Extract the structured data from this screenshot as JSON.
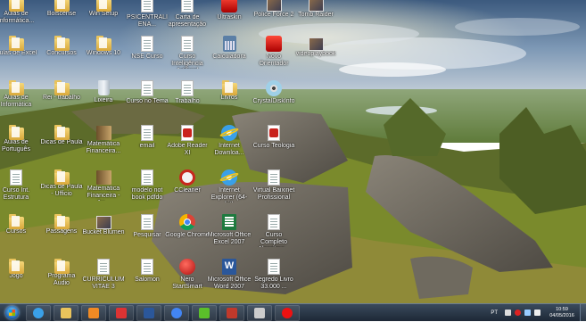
{
  "desktop": {
    "icons": [
      {
        "label": "Aulas de Informática...",
        "icon": "folder-icon",
        "type": "folder"
      },
      {
        "label": "Boiscense",
        "icon": "folder-icon",
        "type": "folder"
      },
      {
        "label": "Win Setup",
        "icon": "folder-icon",
        "type": "folder"
      },
      {
        "label": "PSICENTRALIENA...",
        "icon": "document-icon",
        "type": "doc"
      },
      {
        "label": "Carta de apresentação",
        "icon": "document-icon",
        "type": "doc"
      },
      {
        "label": "Ultraskin",
        "icon": "app-red-icon",
        "type": "redsq"
      },
      {
        "label": "Police Force 2",
        "icon": "game-icon",
        "type": "img"
      },
      {
        "label": "Tomb Raider",
        "icon": "game-icon",
        "type": "img"
      },
      {
        "label": "Aulas de Excel",
        "icon": "folder-icon",
        "type": "folder"
      },
      {
        "label": "Concursos",
        "icon": "folder-icon",
        "type": "folder"
      },
      {
        "label": "Windows 10",
        "icon": "folder-icon",
        "type": "folder"
      },
      {
        "label": "NSE Curso",
        "icon": "document-icon",
        "type": "doc"
      },
      {
        "label": "Curso Inteligência Artificial",
        "icon": "document-icon",
        "type": "doc"
      },
      {
        "label": "Calculadora",
        "icon": "calculator-icon",
        "type": "calc"
      },
      {
        "label": "Novo Orientador",
        "icon": "shortcut-icon",
        "type": "redsq"
      },
      {
        "label": "videoplaybook",
        "icon": "image-icon",
        "type": "img"
      },
      {
        "label": "Aulas de Informática",
        "icon": "folder-icon",
        "type": "folder"
      },
      {
        "label": "Rei - trabalho",
        "icon": "folder-icon",
        "type": "folder"
      },
      {
        "label": "Lixeira",
        "icon": "recycle-bin-icon",
        "type": "bin"
      },
      {
        "label": "Curso no Tema",
        "icon": "document-icon",
        "type": "doc"
      },
      {
        "label": "Trabalho",
        "icon": "document-icon",
        "type": "doc"
      },
      {
        "label": "Livros",
        "icon": "folder-icon",
        "type": "folder"
      },
      {
        "label": "CrystalDiskInfo",
        "icon": "disc-icon",
        "type": "cdrom"
      },
      {
        "label": "Aulas de Português",
        "icon": "folder-icon",
        "type": "folder"
      },
      {
        "label": "Dicas de Paula",
        "icon": "folder-icon",
        "type": "folder"
      },
      {
        "label": "Matemática Financeira...",
        "icon": "book-icon",
        "type": "book"
      },
      {
        "label": "email",
        "icon": "document-icon",
        "type": "doc"
      },
      {
        "label": "Adobe Reader XI",
        "icon": "pdf-icon",
        "type": "pdf"
      },
      {
        "label": "Internet Downloa...",
        "icon": "ie-icon",
        "type": "ie"
      },
      {
        "label": "Curso Teologia",
        "icon": "pdf-icon",
        "type": "pdf"
      },
      {
        "label": "Curso Int. Estrutura",
        "icon": "document-icon",
        "type": "doc"
      },
      {
        "label": "Dicas de Paula - Ufficio",
        "icon": "folder-icon",
        "type": "folder"
      },
      {
        "label": "Matemática Financeira - Au...",
        "icon": "book-icon",
        "type": "book"
      },
      {
        "label": "modelo not book pdfdo",
        "icon": "document-icon",
        "type": "doc"
      },
      {
        "label": "CCleaner",
        "icon": "ccleaner-icon",
        "type": "ccleaner"
      },
      {
        "label": "Internet Explorer (64-bit)",
        "icon": "ie-icon",
        "type": "ie"
      },
      {
        "label": "Virtual Baixinet Profissional",
        "icon": "document-icon",
        "type": "doc"
      },
      {
        "label": "Cursos",
        "icon": "folder-icon",
        "type": "folder"
      },
      {
        "label": "Passagens",
        "icon": "folder-icon",
        "type": "folder"
      },
      {
        "label": "Bucket Blumen",
        "icon": "image-icon",
        "type": "img"
      },
      {
        "label": "Pesquisar",
        "icon": "document-icon",
        "type": "doc"
      },
      {
        "label": "Google Chrome",
        "icon": "chrome-icon",
        "type": "chrome"
      },
      {
        "label": "Microsoft Office Excel 2007",
        "icon": "excel-icon",
        "type": "excel"
      },
      {
        "label": "Curso Completo Algoritmo...",
        "icon": "document-icon",
        "type": "doc"
      },
      {
        "label": "Jogo",
        "icon": "folder-icon",
        "type": "folder"
      },
      {
        "label": "Programa Audio",
        "icon": "folder-icon",
        "type": "folder"
      },
      {
        "label": "CURRICULUM VITAE 3",
        "icon": "word-doc-icon",
        "type": "doc"
      },
      {
        "label": "Salomon",
        "icon": "document-icon",
        "type": "doc"
      },
      {
        "label": "Nero StartSmart",
        "icon": "nero-icon",
        "type": "red"
      },
      {
        "label": "Microsoft Office Word 2007",
        "icon": "word-icon",
        "type": "word"
      },
      {
        "label": "Segredo Livro 33.000 ...",
        "icon": "document-icon",
        "type": "doc"
      }
    ]
  },
  "taskbar": {
    "start_icon": "windows-orb-icon",
    "pinned": [
      {
        "name": "internet-explorer",
        "icon": "ie-icon",
        "color": "#3aa0e8"
      },
      {
        "name": "file-explorer",
        "icon": "folder-icon",
        "color": "#e9c35c"
      },
      {
        "name": "media-player",
        "icon": "media-icon",
        "color": "#f08a24"
      },
      {
        "name": "paint",
        "icon": "paint-icon",
        "color": "#d33"
      },
      {
        "name": "word",
        "icon": "word-icon",
        "color": "#2b579a"
      },
      {
        "name": "chrome",
        "icon": "chrome-icon",
        "color": "#4285f4"
      },
      {
        "name": "utorrent",
        "icon": "torrent-icon",
        "color": "#5bbf2a"
      },
      {
        "name": "flash",
        "icon": "flash-icon",
        "color": "#c0392b"
      },
      {
        "name": "camera",
        "icon": "camera-icon",
        "color": "#ccc"
      },
      {
        "name": "recorder",
        "icon": "record-icon",
        "color": "#e11"
      }
    ],
    "language": "PT",
    "time": "10:59",
    "date": "04/05/2016"
  }
}
